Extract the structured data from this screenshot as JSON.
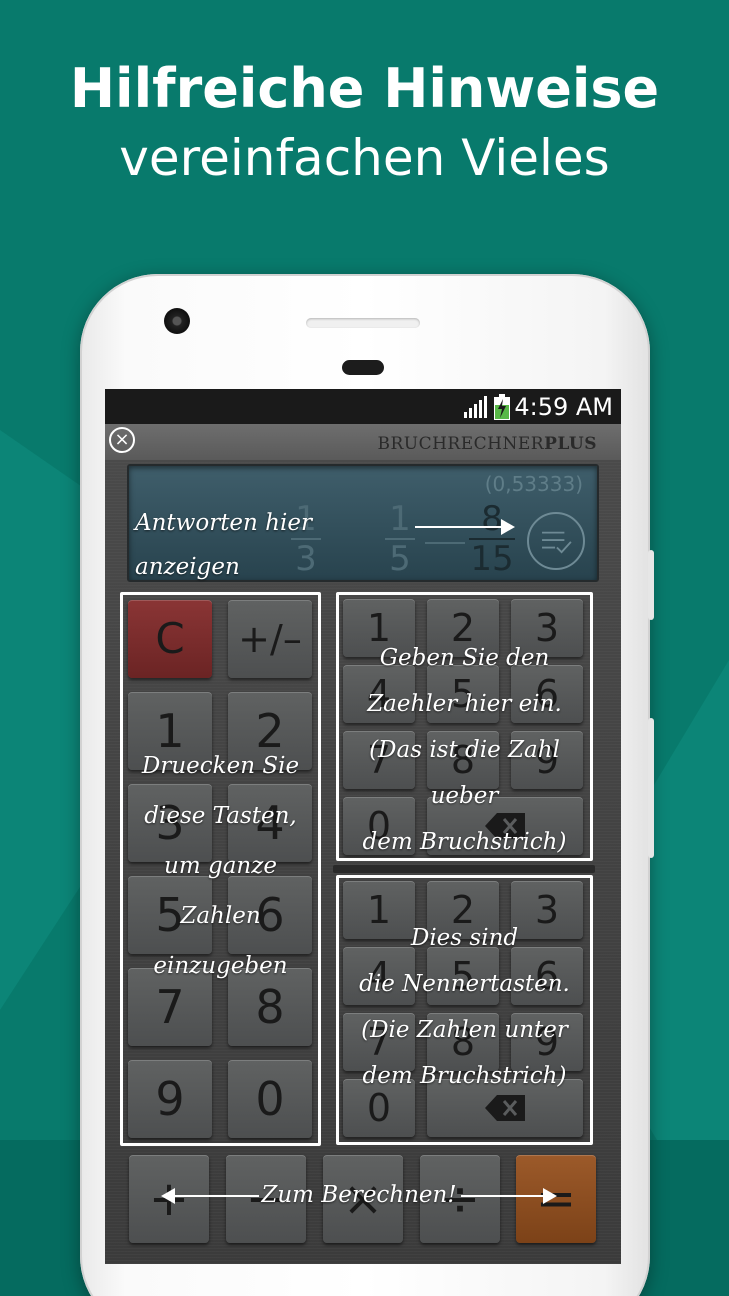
{
  "headline": {
    "line1": "Hilfreiche Hinweise",
    "line2": "vereinfachen Vieles"
  },
  "status_bar": {
    "time": "4:59 AM",
    "icons": [
      "signal-icon",
      "battery-charging-icon"
    ]
  },
  "app": {
    "brand_regular": "BRUCHRECHNER",
    "brand_bold": "PLUS",
    "close_icon": "close-circle-icon"
  },
  "display": {
    "decimal": "(0,53333)",
    "fractions": [
      {
        "numerator": "1",
        "denominator": "3"
      },
      {
        "numerator": "1",
        "denominator": "5"
      },
      {
        "numerator": "8",
        "denominator": "15"
      }
    ],
    "check_icon": "list-check-icon"
  },
  "whole_keys": {
    "labels": [
      "C",
      "+/–",
      "1",
      "2",
      "3",
      "4",
      "5",
      "6",
      "7",
      "8",
      "9",
      "0"
    ]
  },
  "numerator_keys": {
    "labels": [
      "1",
      "2",
      "3",
      "4",
      "5",
      "6",
      "7",
      "8",
      "9",
      "0"
    ],
    "backspace_icon": "backspace-icon"
  },
  "denominator_keys": {
    "labels": [
      "1",
      "2",
      "3",
      "4",
      "5",
      "6",
      "7",
      "8",
      "9",
      "0"
    ],
    "backspace_icon": "backspace-icon"
  },
  "operator_keys": {
    "labels": [
      "+",
      "−",
      "×",
      "÷",
      "="
    ]
  },
  "hints": {
    "display": "Antworten hier anzeigen",
    "whole": [
      "Druecken Sie",
      "diese Tasten,",
      "um ganze",
      "Zahlen",
      "einzugeben"
    ],
    "numerator": [
      "Geben Sie den",
      "Zaehler hier ein.",
      "(Das ist die Zahl ueber",
      "dem Bruchstrich)"
    ],
    "denominator": [
      "Dies sind",
      "die Nennertasten.",
      "(Die Zahlen unter",
      "dem Bruchstrich)"
    ],
    "calculate": "Zum Berechnen!"
  },
  "colors": {
    "background": "#087a6c",
    "clear_key": "#7a2c2c",
    "equals_key": "#8c4e22",
    "hint": "#ffffff"
  }
}
